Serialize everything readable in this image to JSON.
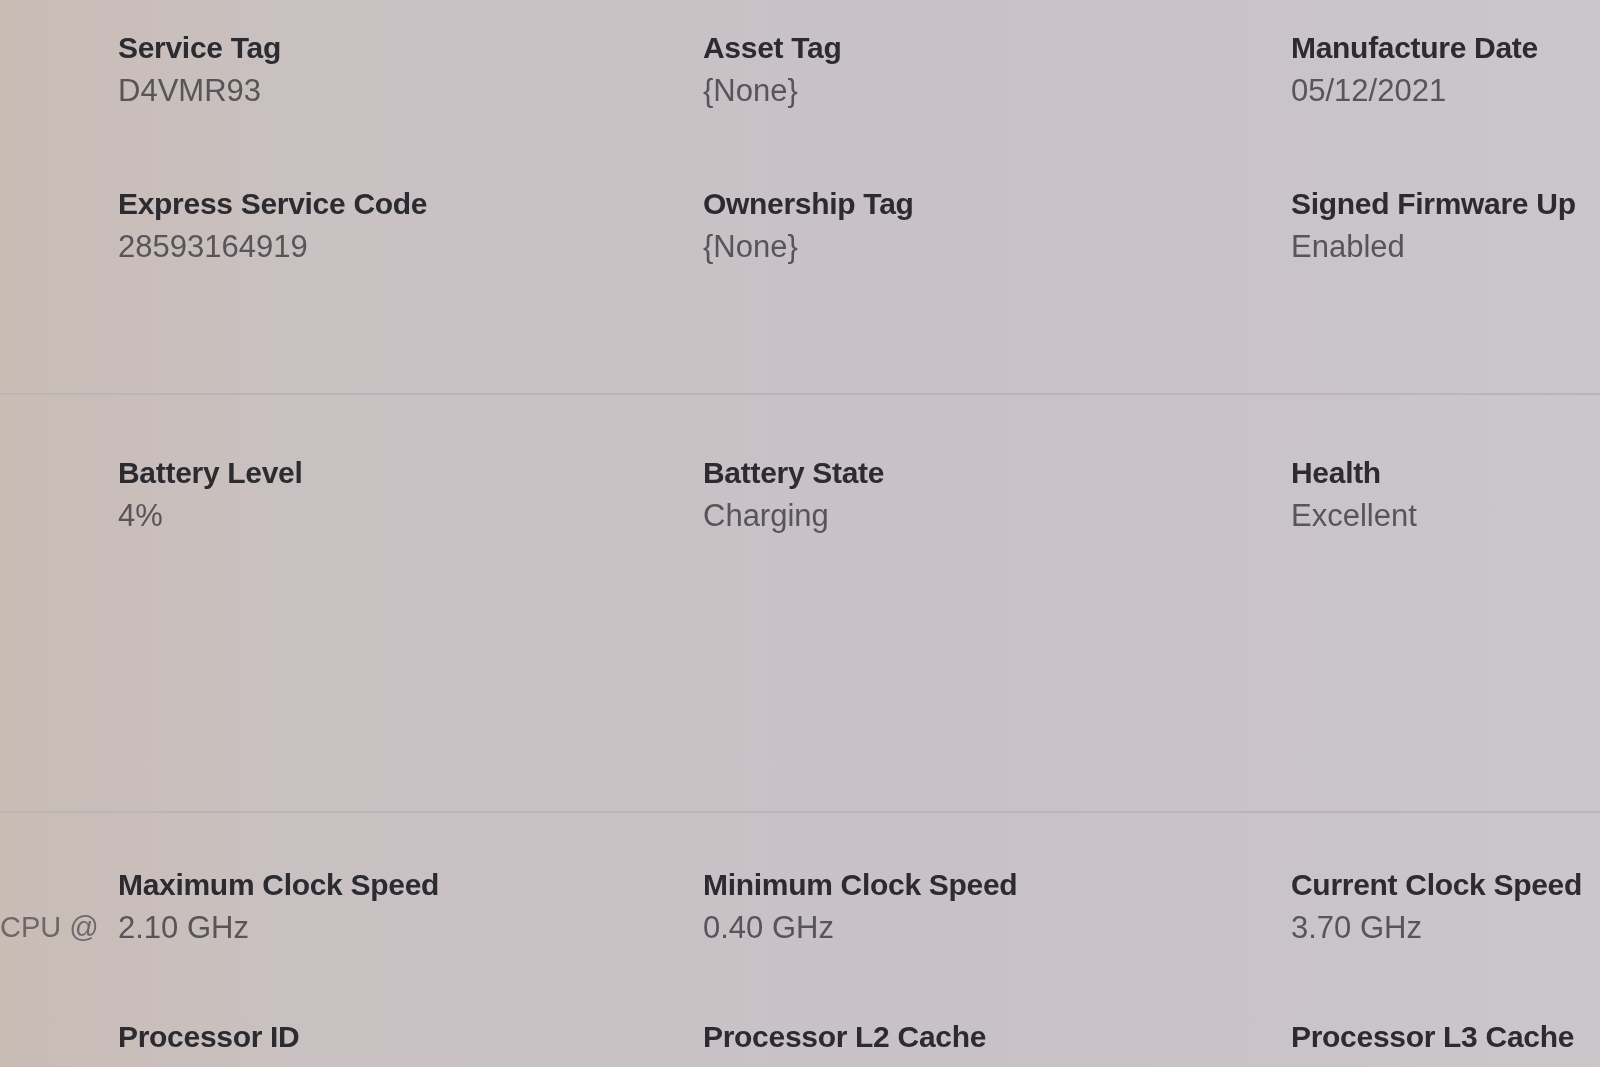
{
  "sections": [
    {
      "rows": [
        {
          "fields": [
            {
              "label": "Service Tag",
              "value": "D4VMR93"
            },
            {
              "label": "Asset Tag",
              "value": "{None}"
            },
            {
              "label": "Manufacture Date",
              "value": "05/12/2021"
            }
          ]
        },
        {
          "fields": [
            {
              "label": "Express Service Code",
              "value": "28593164919"
            },
            {
              "label": "Ownership Tag",
              "value": "{None}"
            },
            {
              "label": "Signed Firmware Up",
              "value": "Enabled"
            }
          ]
        }
      ]
    },
    {
      "rows": [
        {
          "fields": [
            {
              "label": "Battery Level",
              "value": "4%"
            },
            {
              "label": "Battery State",
              "value": "Charging"
            },
            {
              "label": "Health",
              "value": "Excellent"
            }
          ]
        }
      ]
    },
    {
      "rows": [
        {
          "side_text": "CPU @",
          "fields": [
            {
              "label": "Maximum Clock Speed",
              "value": "2.10 GHz"
            },
            {
              "label": "Minimum Clock Speed",
              "value": "0.40 GHz"
            },
            {
              "label": "Current Clock Speed",
              "value": "3.70 GHz"
            }
          ]
        },
        {
          "fields": [
            {
              "label": "Processor ID"
            },
            {
              "label": "Processor L2 Cache"
            },
            {
              "label": "Processor L3 Cache"
            }
          ]
        }
      ]
    }
  ]
}
